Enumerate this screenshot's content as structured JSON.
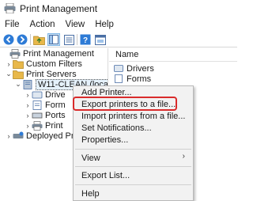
{
  "window": {
    "title": "Print Management"
  },
  "menu": [
    "File",
    "Action",
    "View",
    "Help"
  ],
  "toolbar": {
    "buttons": [
      "back-icon",
      "forward-icon",
      "up-folder-icon",
      "show-hide-tree-icon",
      "export-list-icon",
      "help-icon",
      "properties-icon"
    ]
  },
  "tree": {
    "root": "Print Management",
    "custom_filters": "Custom Filters",
    "print_servers": "Print Servers",
    "server": "W11-CLEAN (local)",
    "drivers": "Drive",
    "forms": "Form",
    "ports": "Ports",
    "printers": "Print",
    "deployed": "Deployed Pr"
  },
  "right_pane": {
    "header": "Name",
    "items": [
      "Drivers",
      "Forms"
    ]
  },
  "context_menu": {
    "add_printer": "Add Printer...",
    "export_printers": "Export printers to a file...",
    "import_printers": "Import printers from a file...",
    "set_notifications": "Set Notifications...",
    "properties": "Properties...",
    "view": "View",
    "export_list": "Export List...",
    "help": "Help",
    "highlighted_item": "Export printers to a file..."
  },
  "colors": {
    "highlight_border": "#d92b2b",
    "selection_bg": "#e5f1fb",
    "menu_bg": "#f2f2f2"
  }
}
